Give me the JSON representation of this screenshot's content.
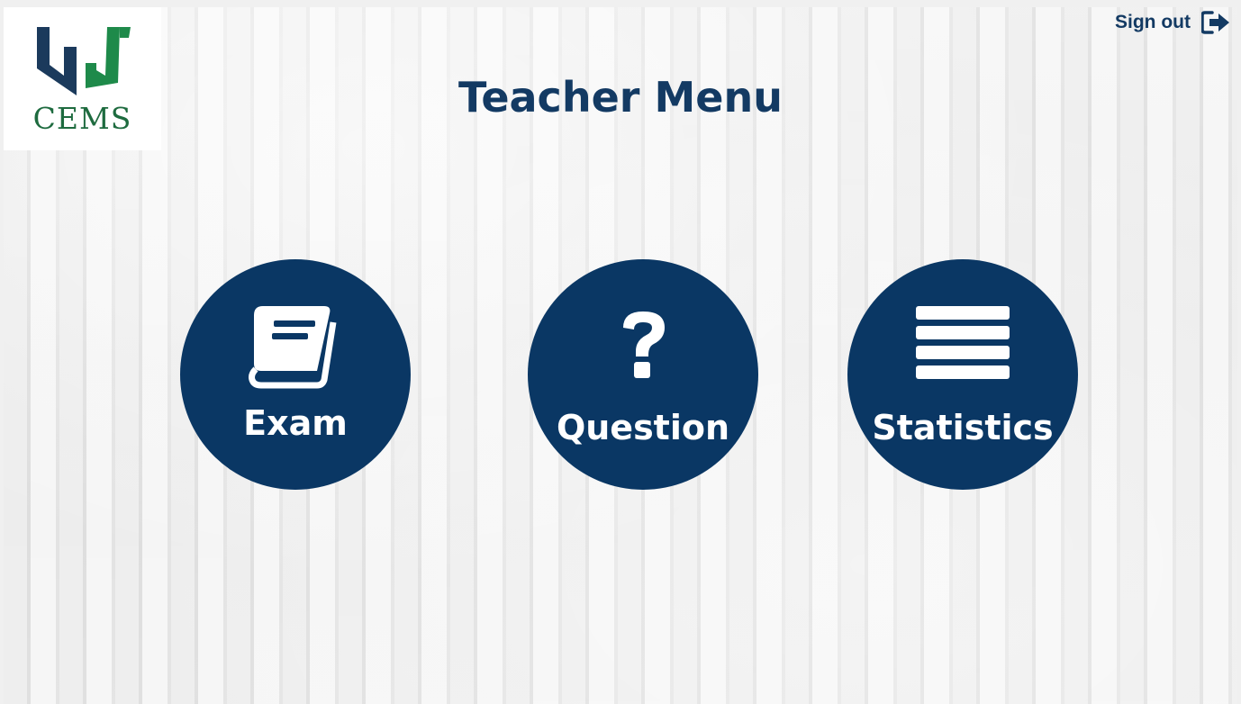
{
  "app": {
    "logo_text": "CEMS",
    "logo_colors": {
      "navy": "#1b3a5c",
      "green": "#1e8a4a",
      "text": "#1e6b3f"
    }
  },
  "header": {
    "title": "Teacher Menu",
    "sign_out_label": "Sign out",
    "sign_out_icon": "sign-out-icon"
  },
  "menu": {
    "items": [
      {
        "label": "Exam",
        "icon": "book-icon"
      },
      {
        "label": "Question",
        "icon": "question-mark-icon"
      },
      {
        "label": "Statistics",
        "icon": "list-icon"
      }
    ]
  },
  "colors": {
    "accent": "#0a3764",
    "title": "#133a63",
    "button_text": "#ffffff"
  }
}
